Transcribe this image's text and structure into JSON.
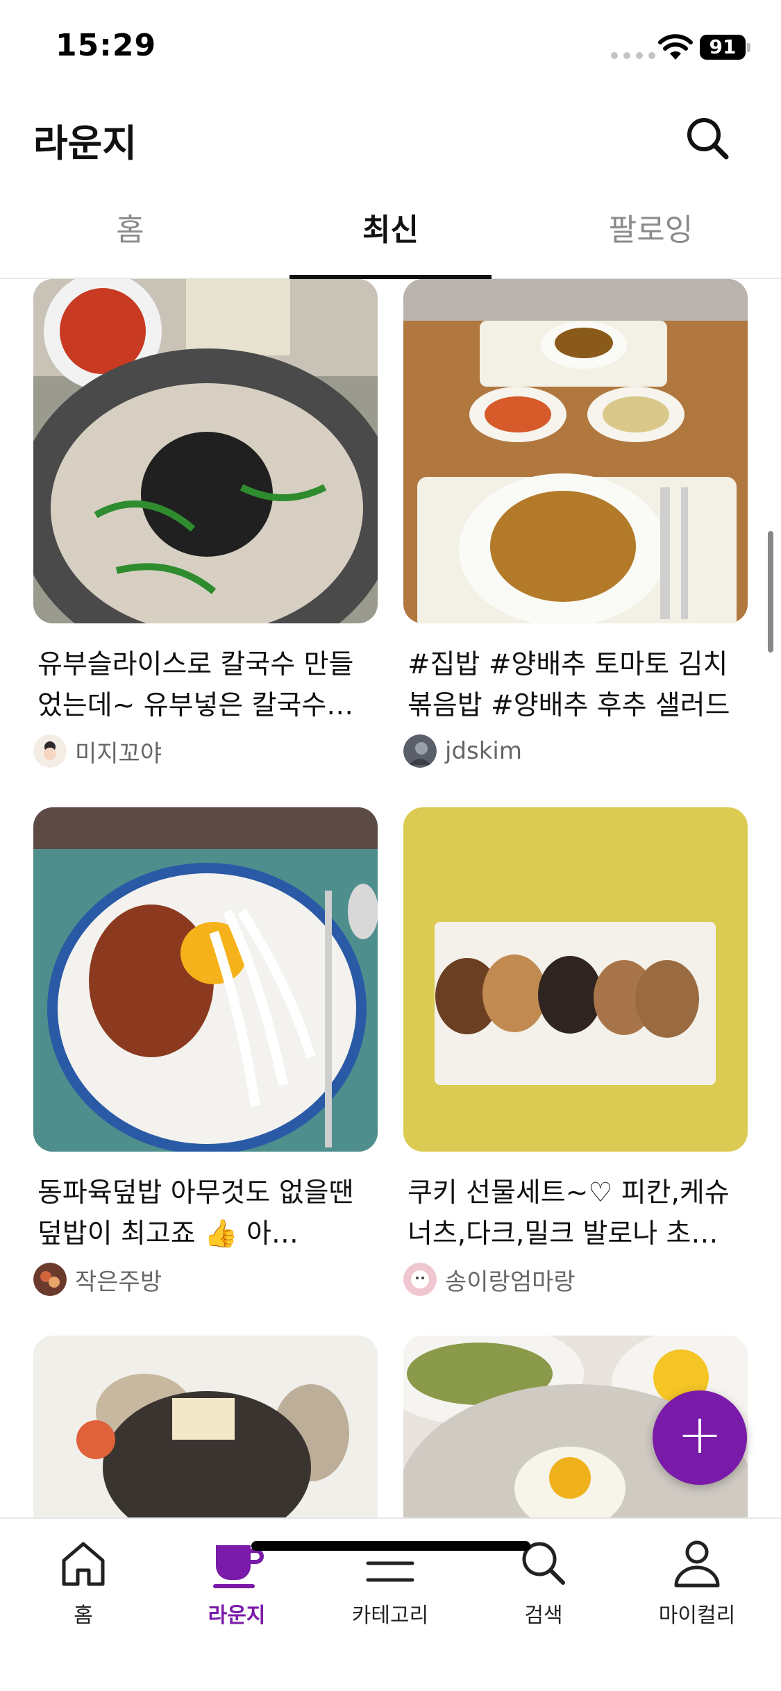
{
  "status_bar": {
    "time": "15:29",
    "battery": "91"
  },
  "header": {
    "title": "라운지",
    "search_icon": "search-icon"
  },
  "tabs": [
    {
      "label": "홈",
      "active": false
    },
    {
      "label": "최신",
      "active": true
    },
    {
      "label": "팔로잉",
      "active": false
    }
  ],
  "posts": [
    {
      "text": "유부슬라이스로 칼국수 만들었는데~ 유부넣은 칼국수…",
      "author": "미지꼬야",
      "image": "kalguksu-photo"
    },
    {
      "text": "#집밥 #양배추 토마토 김치볶음밥 #양배추 후추 샐러드",
      "author": "jdskim",
      "image": "kimchi-fried-rice-photo"
    },
    {
      "text": "동파육덮밥  아무것도 없을땐 덮밥이 최고죠 👍  아…",
      "author": "작은주방",
      "image": "pork-rice-bowl-photo"
    },
    {
      "text": "쿠키 선물세트~♡ 피칸,케슈너츠,다크,밀크 발로나 초…",
      "author": "송이랑엄마랑",
      "image": "cookies-photo"
    },
    {
      "text": "",
      "author": "",
      "image": "clam-dish-photo"
    },
    {
      "text": "",
      "author": "",
      "image": "pasta-eggs-photo"
    }
  ],
  "fab": {
    "label": "+"
  },
  "bottom_nav": [
    {
      "label": "홈",
      "icon": "home-icon",
      "active": false
    },
    {
      "label": "라운지",
      "icon": "coffee-cup-icon",
      "active": true
    },
    {
      "label": "카테고리",
      "icon": "menu-icon",
      "active": false
    },
    {
      "label": "검색",
      "icon": "search-icon",
      "active": false
    },
    {
      "label": "마이컬리",
      "icon": "person-icon",
      "active": false
    }
  ],
  "colors": {
    "accent": "#7a1aa8",
    "text": "#111111",
    "muted": "#8a8a8a"
  }
}
